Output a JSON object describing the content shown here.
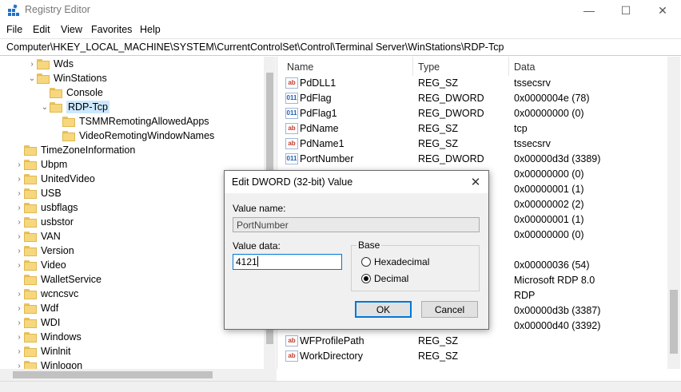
{
  "window": {
    "title": "Registry Editor",
    "minimize": "—",
    "maximize": "☐",
    "close": "✕"
  },
  "menu": [
    "File",
    "Edit",
    "View",
    "Favorites",
    "Help"
  ],
  "address": "Computer\\HKEY_LOCAL_MACHINE\\SYSTEM\\CurrentControlSet\\Control\\Terminal Server\\WinStations\\RDP-Tcp",
  "tree": [
    {
      "label": "Wds",
      "expander": "›",
      "selected": false
    },
    {
      "label": "WinStations",
      "expander": "⌄",
      "selected": false
    },
    {
      "label": "Console",
      "expander": "",
      "selected": false
    },
    {
      "label": "RDP-Tcp",
      "expander": "⌄",
      "selected": true
    },
    {
      "label": "TSMMRemotingAllowedApps",
      "expander": "",
      "selected": false
    },
    {
      "label": "VideoRemotingWindowNames",
      "expander": "",
      "selected": false
    },
    {
      "label": "TimeZoneInformation",
      "expander": "",
      "selected": false
    },
    {
      "label": "Ubpm",
      "expander": "›",
      "selected": false
    },
    {
      "label": "UnitedVideo",
      "expander": "›",
      "selected": false
    },
    {
      "label": "USB",
      "expander": "›",
      "selected": false
    },
    {
      "label": "usbflags",
      "expander": "›",
      "selected": false
    },
    {
      "label": "usbstor",
      "expander": "›",
      "selected": false
    },
    {
      "label": "VAN",
      "expander": "›",
      "selected": false
    },
    {
      "label": "Version",
      "expander": "›",
      "selected": false
    },
    {
      "label": "Video",
      "expander": "›",
      "selected": false
    },
    {
      "label": "WalletService",
      "expander": "",
      "selected": false
    },
    {
      "label": "wcncsvc",
      "expander": "›",
      "selected": false
    },
    {
      "label": "Wdf",
      "expander": "›",
      "selected": false
    },
    {
      "label": "WDI",
      "expander": "›",
      "selected": false
    },
    {
      "label": "Windows",
      "expander": "›",
      "selected": false
    },
    {
      "label": "Winlnit",
      "expander": "›",
      "selected": false
    },
    {
      "label": "Winlogon",
      "expander": "›",
      "selected": false
    }
  ],
  "list": {
    "columns": [
      "Name",
      "Type",
      "Data"
    ],
    "rows": [
      {
        "name": "PdDLL1",
        "type": "REG_SZ",
        "data": "tssecsrv",
        "icon": "string-value-icon"
      },
      {
        "name": "PdFlag",
        "type": "REG_DWORD",
        "data": "0x0000004e (78)",
        "icon": "binary-value-icon"
      },
      {
        "name": "PdFlag1",
        "type": "REG_DWORD",
        "data": "0x00000000 (0)",
        "icon": "binary-value-icon"
      },
      {
        "name": "PdName",
        "type": "REG_SZ",
        "data": "tcp",
        "icon": "string-value-icon"
      },
      {
        "name": "PdName1",
        "type": "REG_SZ",
        "data": "tssecsrv",
        "icon": "string-value-icon"
      },
      {
        "name": "PortNumber",
        "type": "REG_DWORD",
        "data": "0x00000d3d (3389)",
        "icon": "binary-value-icon"
      },
      {
        "name": "",
        "type": "",
        "data": "0x00000000 (0)",
        "icon": ""
      },
      {
        "name": "",
        "type": "",
        "data": "0x00000001 (1)",
        "icon": ""
      },
      {
        "name": "",
        "type": "",
        "data": "0x00000002 (2)",
        "icon": ""
      },
      {
        "name": "",
        "type": "",
        "data": "0x00000001 (1)",
        "icon": ""
      },
      {
        "name": "",
        "type": "",
        "data": "0x00000000 (0)",
        "icon": ""
      },
      {
        "name": "",
        "type": "",
        "data": "",
        "icon": ""
      },
      {
        "name": "",
        "type": "",
        "data": "0x00000036 (54)",
        "icon": ""
      },
      {
        "name": "",
        "type": "",
        "data": "Microsoft RDP 8.0",
        "icon": ""
      },
      {
        "name": "",
        "type": "",
        "data": "RDP",
        "icon": ""
      },
      {
        "name": "",
        "type": "",
        "data": "0x00000d3b (3387)",
        "icon": ""
      },
      {
        "name": "",
        "type": "",
        "data": "0x00000d40 (3392)",
        "icon": ""
      },
      {
        "name": "WFProfilePath",
        "type": "REG_SZ",
        "data": "",
        "icon": "string-value-icon"
      },
      {
        "name": "WorkDirectory",
        "type": "REG_SZ",
        "data": "",
        "icon": "string-value-icon"
      }
    ]
  },
  "dialog": {
    "title": "Edit DWORD (32-bit) Value",
    "value_name_label": "Value name:",
    "value_name": "PortNumber",
    "value_data_label": "Value data:",
    "value_data": "4121",
    "base_label": "Base",
    "hex_label": "Hexadecimal",
    "dec_label": "Decimal",
    "selected_base": "Decimal",
    "ok": "OK",
    "cancel": "Cancel",
    "close": "✕"
  },
  "colors": {
    "selection": "#cce8ff",
    "accent": "#0078d7",
    "folder": "#f6d77d"
  }
}
